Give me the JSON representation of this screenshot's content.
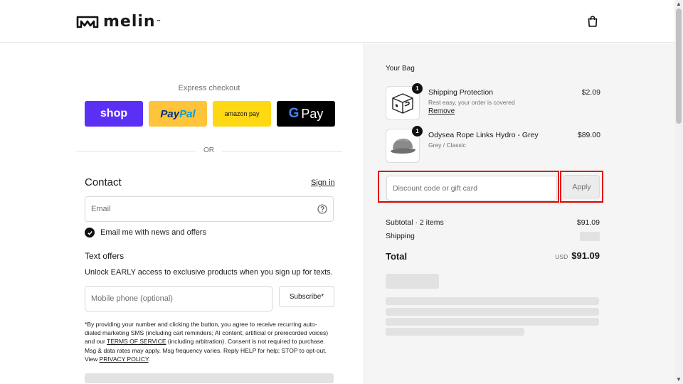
{
  "header": {
    "brand": "melin",
    "brand_tm": "™",
    "logo_icon": "melin-logo-icon",
    "bag_icon": "shopping-bag-icon"
  },
  "express": {
    "label": "Express checkout",
    "shop": "shop",
    "paypal_a": "Pay",
    "paypal_b": "Pal",
    "amazon": "amazon pay",
    "gpay_g": "G",
    "gpay_text": "Pay",
    "colors": {
      "shop": "#5a31f4",
      "paypal": "#ffc439",
      "amazon": "#ffd814",
      "gpay": "#000000"
    }
  },
  "or_text": "OR",
  "contact": {
    "title": "Contact",
    "signin": "Sign in",
    "email_placeholder": "Email",
    "email_value": "",
    "help_icon": "question-circle-icon",
    "newsletter_label": "Email me with news and offers",
    "newsletter_checked": true
  },
  "text_offers": {
    "title": "Text offers",
    "desc": "Unlock EARLY access to exclusive products when you sign up for texts.",
    "phone_placeholder": "Mobile phone (optional)",
    "subscribe": "Subscribe*",
    "disclaimer_1": "*By providing your number and clicking the button, you agree to receive recurring auto-dialed marketing SMS (including cart reminders; AI content; artificial or prerecorded voices) and our ",
    "tos": "TERMS OF SERVICE",
    "disclaimer_2": " (including arbitration). Consent is not required to purchase. Msg & data rates may apply. Msg frequency varies. Reply HELP for help; STOP to opt-out. View ",
    "privacy": "PRIVACY POLICY",
    "disclaimer_3": "."
  },
  "bag": {
    "title": "Your Bag",
    "items": [
      {
        "name": "Shipping Protection",
        "sub": "Rest easy, your order is covered",
        "action": "Remove",
        "price": "$2.09",
        "qty": "1"
      },
      {
        "name": "Odysea Rope Links Hydro - Grey",
        "sub": "Grey / Classic",
        "price": "$89.00",
        "qty": "1"
      }
    ]
  },
  "discount": {
    "placeholder": "Discount code or gift card",
    "apply": "Apply",
    "highlight_color": "#e00000"
  },
  "summary": {
    "subtotal_label": "Subtotal · 2 items",
    "subtotal_value": "$91.09",
    "shipping_label": "Shipping",
    "total_label": "Total",
    "currency": "USD",
    "total_value": "$91.09"
  }
}
